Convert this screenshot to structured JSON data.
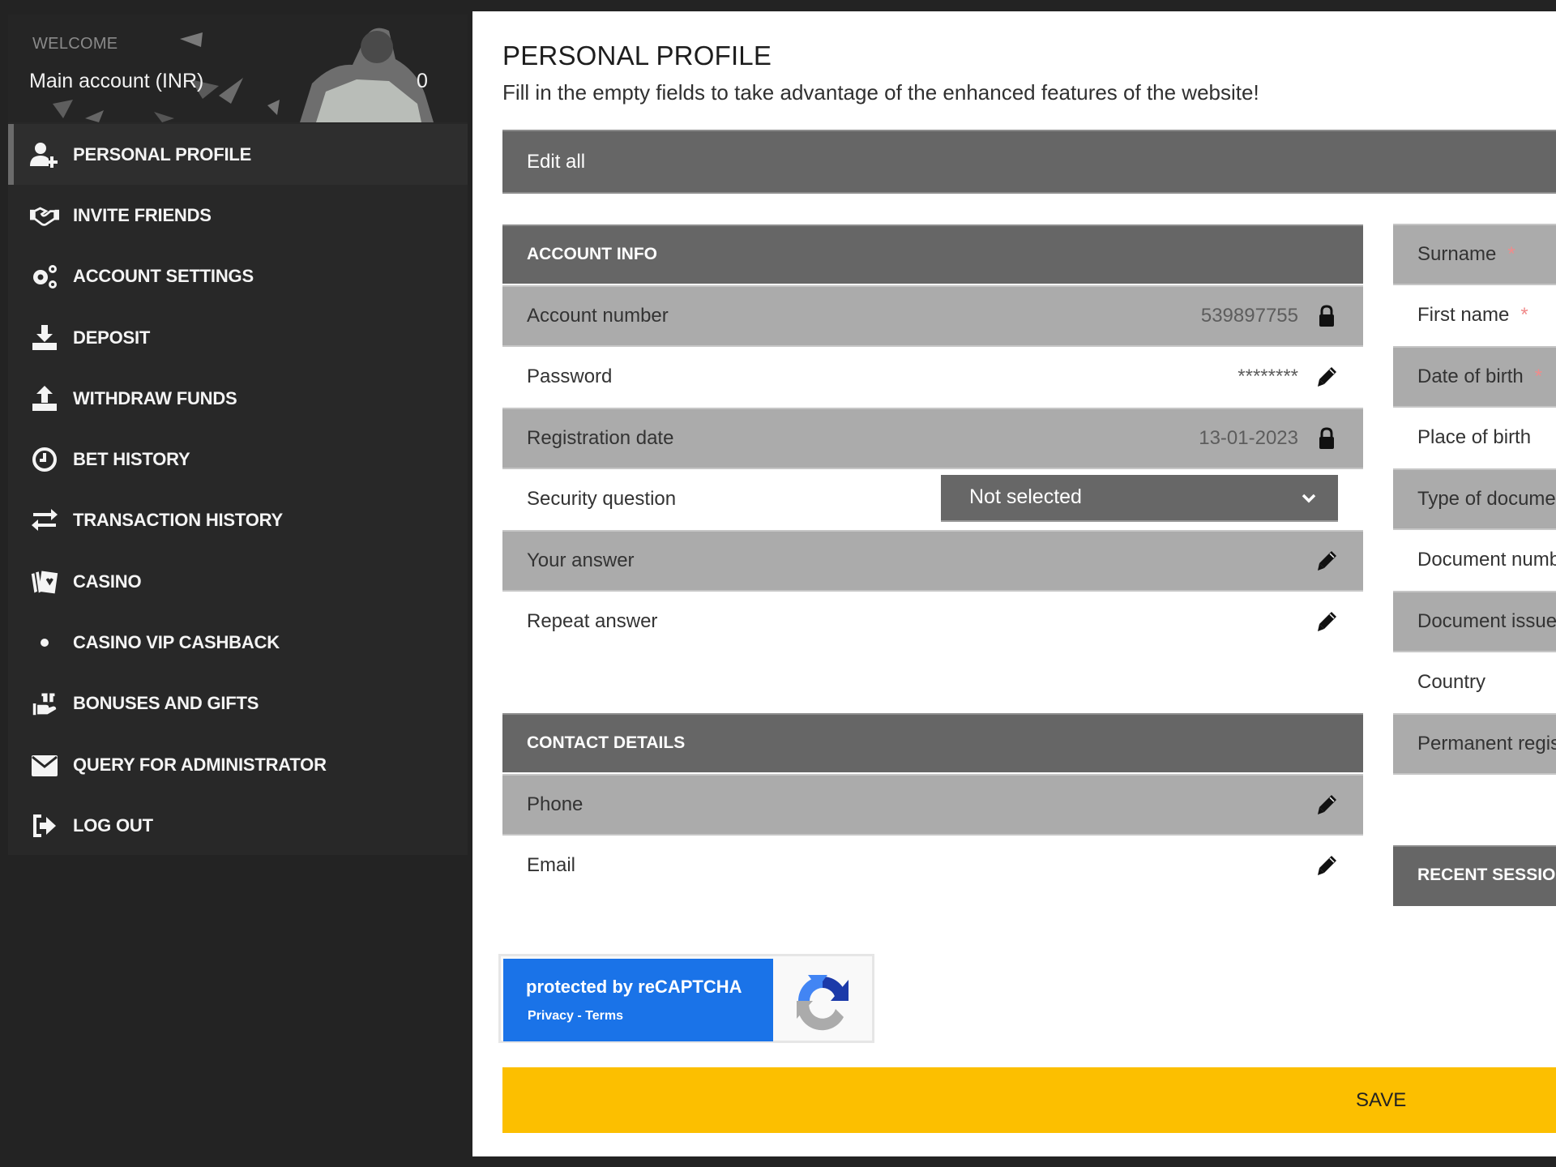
{
  "sidebar": {
    "welcome": "WELCOME",
    "account_label": "Main account (INR)",
    "balance": "0",
    "items": [
      {
        "label": "PERSONAL PROFILE",
        "icon": "user-plus-icon",
        "active": true
      },
      {
        "label": "INVITE FRIENDS",
        "icon": "handshake-icon"
      },
      {
        "label": "ACCOUNT SETTINGS",
        "icon": "gears-icon"
      },
      {
        "label": "DEPOSIT",
        "icon": "download-tray-icon"
      },
      {
        "label": "WITHDRAW FUNDS",
        "icon": "upload-tray-icon"
      },
      {
        "label": "BET HISTORY",
        "icon": "clock-icon"
      },
      {
        "label": "TRANSACTION HISTORY",
        "icon": "exchange-arrows-icon"
      },
      {
        "label": "CASINO",
        "icon": "playing-cards-icon"
      },
      {
        "label": "CASINO VIP CASHBACK",
        "icon": "dot-icon"
      },
      {
        "label": "BONUSES AND GIFTS",
        "icon": "gift-hand-icon"
      },
      {
        "label": "QUERY FOR ADMINISTRATOR",
        "icon": "envelope-icon"
      },
      {
        "label": "LOG OUT",
        "icon": "logout-icon"
      }
    ]
  },
  "main": {
    "title": "PERSONAL PROFILE",
    "subtitle": "Fill in the empty fields to take advantage of the enhanced features of the website!",
    "edit_all": "Edit all",
    "account_info": {
      "heading": "ACCOUNT INFO",
      "rows": [
        {
          "label": "Account number",
          "value": "539897755",
          "icon": "lock-icon"
        },
        {
          "label": "Password",
          "value": "********",
          "icon": "pencil-icon"
        },
        {
          "label": "Registration date",
          "value": "13-01-2023",
          "icon": "lock-icon"
        },
        {
          "label": "Security question",
          "select": "Not selected"
        },
        {
          "label": "Your answer",
          "value": "",
          "icon": "pencil-icon"
        },
        {
          "label": "Repeat answer",
          "value": "",
          "icon": "pencil-icon"
        }
      ]
    },
    "contact_details": {
      "heading": "CONTACT DETAILS",
      "rows": [
        {
          "label": "Phone",
          "value": "",
          "icon": "pencil-icon"
        },
        {
          "label": "Email",
          "value": "",
          "icon": "pencil-icon"
        }
      ]
    },
    "personal_info": {
      "rows": [
        {
          "label": "Surname",
          "required": "*"
        },
        {
          "label": "First name",
          "required": "*"
        },
        {
          "label": "Date of birth",
          "required": "*"
        },
        {
          "label": "Place of birth",
          "required": ""
        },
        {
          "label": "Type of document",
          "required": ""
        },
        {
          "label": "Document number",
          "required": ""
        },
        {
          "label": "Document issue",
          "required": ""
        },
        {
          "label": "Country",
          "required": ""
        },
        {
          "label": "Permanent registration",
          "required": ""
        }
      ]
    },
    "recent_sessions_heading": "RECENT SESSIONS",
    "recaptcha": {
      "title": "protected by reCAPTCHA",
      "links": "Privacy - Terms"
    },
    "save": "SAVE"
  },
  "colors": {
    "accent": "#fcbf00",
    "sidebar_bg": "#282828",
    "section_header": "#666666",
    "row_grey": "#ababab",
    "recaptcha_blue": "#1a73e8",
    "required": "#f08b8b"
  }
}
